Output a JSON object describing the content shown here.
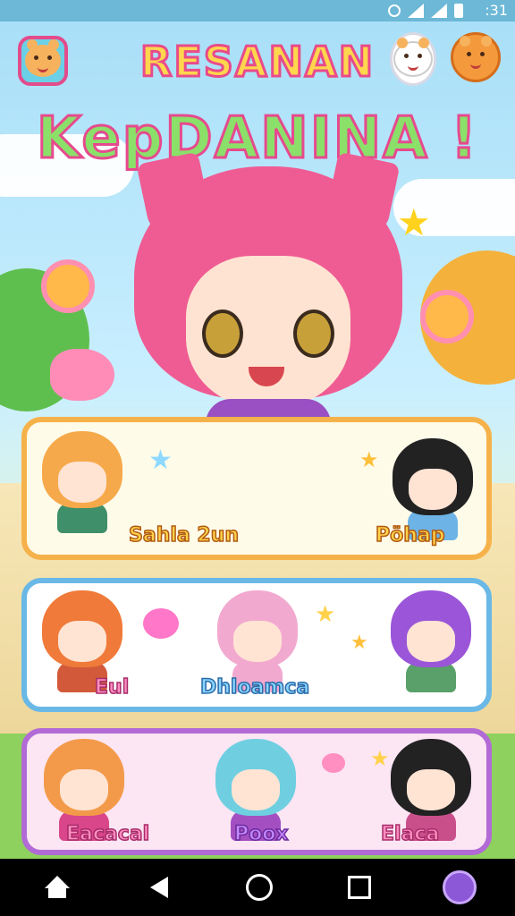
{
  "status_bar": {
    "time": ":31"
  },
  "header": {
    "title_line1": "RESANAN",
    "title_line2": "KepDANINA !"
  },
  "characters": {
    "card1": [
      {
        "name": "Sahla 2un"
      },
      {
        "name": "Pöhap"
      }
    ],
    "card2": [
      {
        "name": "Eul"
      },
      {
        "name": "Dhloamca"
      }
    ],
    "card3": [
      {
        "name": "Eacacal"
      },
      {
        "name": "Poox"
      },
      {
        "name": "Elaca"
      }
    ]
  },
  "colors": {
    "accent_pink": "#ef5c93",
    "card1_border": "#f6b24a",
    "card2_border": "#6ab8e6",
    "card3_border": "#b26ad6",
    "nav_bg": "#000000"
  },
  "icons": {
    "menu": "bear-face-icon",
    "chat": "chat-bubble-icon",
    "profile": "bear-icon",
    "nav_home": "home-icon",
    "nav_back": "back-icon",
    "nav_home_circle": "home-circle-icon",
    "nav_recents": "recents-icon",
    "nav_app": "app-icon"
  }
}
